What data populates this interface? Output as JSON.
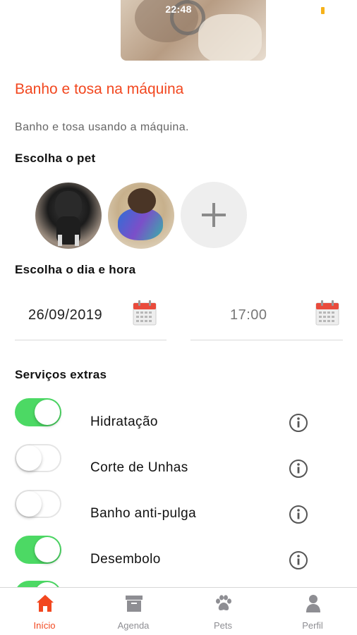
{
  "status_bar": {
    "time": "22:48"
  },
  "header": {
    "title": "Banho e tosa na máquina",
    "subtitle": "Banho e tosa usando a máquina."
  },
  "pet_section": {
    "label": "Escolha o pet",
    "pets": [
      {
        "name": "pet-bulldog"
      },
      {
        "name": "pet-yorkshire"
      }
    ],
    "add_icon": "plus-icon"
  },
  "datetime_section": {
    "label": "Escolha o dia e hora",
    "date_value": "26/09/2019",
    "time_value": "17:00",
    "icon": "calendar-icon"
  },
  "extras_section": {
    "label": "Serviços extras",
    "services": [
      {
        "label": "Hidratação",
        "enabled": true
      },
      {
        "label": "Corte de Unhas",
        "enabled": false
      },
      {
        "label": "Banho anti-pulga",
        "enabled": false
      },
      {
        "label": "Desembolo",
        "enabled": true
      },
      {
        "label": "",
        "enabled": true
      }
    ],
    "info_icon": "info-icon"
  },
  "tabbar": {
    "tabs": [
      {
        "label": "Início",
        "icon": "home-icon",
        "active": true
      },
      {
        "label": "Agenda",
        "icon": "archive-box-icon",
        "active": false
      },
      {
        "label": "Pets",
        "icon": "paw-icon",
        "active": false
      },
      {
        "label": "Perfil",
        "icon": "person-icon",
        "active": false
      }
    ]
  },
  "colors": {
    "accent": "#f2471f",
    "toggle_on": "#4cd964",
    "tab_inactive": "#8e8e93",
    "calendar_red": "#e94b3c"
  }
}
